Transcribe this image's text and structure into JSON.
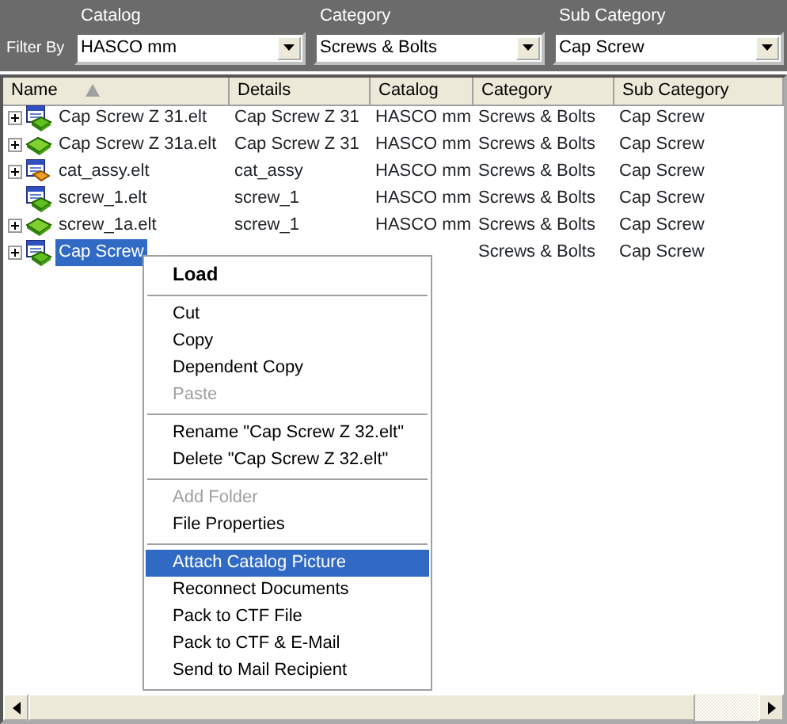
{
  "filter": {
    "label": "Filter By",
    "fields": [
      {
        "caption": "Catalog",
        "value": "HASCO mm"
      },
      {
        "caption": "Category",
        "value": "Screws & Bolts"
      },
      {
        "caption": "Sub Category",
        "value": "Cap Screw"
      }
    ]
  },
  "table": {
    "columns": [
      {
        "label": "Name",
        "sorted": true
      },
      {
        "label": "Details",
        "sorted": false
      },
      {
        "label": "Catalog",
        "sorted": false
      },
      {
        "label": "Category",
        "sorted": false
      },
      {
        "label": "Sub Category",
        "sorted": false
      }
    ],
    "rows": [
      {
        "kind": "document",
        "expandable": true,
        "selected": false,
        "cells": [
          "Cap Screw Z 31.elt",
          "Cap Screw Z 31",
          "HASCO mm",
          "Screws & Bolts",
          "Cap Screw"
        ]
      },
      {
        "kind": "part",
        "expandable": true,
        "selected": false,
        "cells": [
          "Cap Screw Z 31a.elt",
          "Cap Screw Z 31",
          "HASCO mm",
          "Screws & Bolts",
          "Cap Screw"
        ]
      },
      {
        "kind": "assembly",
        "expandable": true,
        "selected": false,
        "cells": [
          "cat_assy.elt",
          "cat_assy",
          "HASCO mm",
          "Screws & Bolts",
          "Cap Screw"
        ]
      },
      {
        "kind": "document",
        "expandable": false,
        "selected": false,
        "cells": [
          "screw_1.elt",
          "screw_1",
          "HASCO mm",
          "Screws & Bolts",
          "Cap Screw"
        ]
      },
      {
        "kind": "part",
        "expandable": true,
        "selected": false,
        "cells": [
          "screw_1a.elt",
          "screw_1",
          "HASCO mm",
          "Screws & Bolts",
          "Cap Screw"
        ]
      },
      {
        "kind": "document",
        "expandable": true,
        "selected": true,
        "cells": [
          "Cap Screw",
          "",
          "",
          "Screws & Bolts",
          "Cap Screw"
        ]
      }
    ]
  },
  "context_menu": [
    {
      "kind": "item",
      "label": "Load",
      "default": true,
      "disabled": false,
      "selected": false
    },
    {
      "kind": "separator"
    },
    {
      "kind": "item",
      "label": "Cut",
      "default": false,
      "disabled": false,
      "selected": false
    },
    {
      "kind": "item",
      "label": "Copy",
      "default": false,
      "disabled": false,
      "selected": false
    },
    {
      "kind": "item",
      "label": "Dependent Copy",
      "default": false,
      "disabled": false,
      "selected": false
    },
    {
      "kind": "item",
      "label": "Paste",
      "default": false,
      "disabled": true,
      "selected": false
    },
    {
      "kind": "separator"
    },
    {
      "kind": "item",
      "label": "Rename \"Cap Screw Z 32.elt\"",
      "default": false,
      "disabled": false,
      "selected": false
    },
    {
      "kind": "item",
      "label": "Delete \"Cap Screw Z 32.elt\"",
      "default": false,
      "disabled": false,
      "selected": false
    },
    {
      "kind": "separator"
    },
    {
      "kind": "item",
      "label": "Add Folder",
      "default": false,
      "disabled": true,
      "selected": false
    },
    {
      "kind": "item",
      "label": "File Properties",
      "default": false,
      "disabled": false,
      "selected": false
    },
    {
      "kind": "separator"
    },
    {
      "kind": "item",
      "label": "Attach Catalog Picture",
      "default": false,
      "disabled": false,
      "selected": true
    },
    {
      "kind": "item",
      "label": "Reconnect Documents",
      "default": false,
      "disabled": false,
      "selected": false
    },
    {
      "kind": "item",
      "label": "Pack to CTF File",
      "default": false,
      "disabled": false,
      "selected": false
    },
    {
      "kind": "item",
      "label": "Pack to CTF & E-Mail",
      "default": false,
      "disabled": false,
      "selected": false
    },
    {
      "kind": "item",
      "label": "Send to Mail Recipient",
      "default": false,
      "disabled": false,
      "selected": false
    }
  ]
}
